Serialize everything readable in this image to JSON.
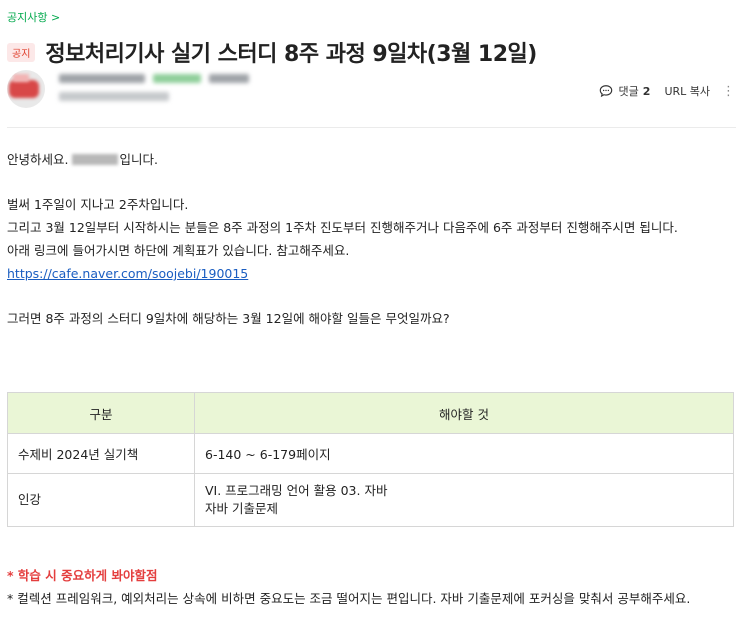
{
  "board": {
    "link_label": "공지사항 >"
  },
  "post": {
    "badge": "공지",
    "title": "정보처리기사 실기 스터디 8주 과정 9일차(3월 12일)"
  },
  "actions": {
    "comment_label": "댓글",
    "comment_count": "2",
    "url_copy": "URL 복사",
    "more": "⋮"
  },
  "body": {
    "greeting_before": "안녕하세요. ",
    "greeting_after": "입니다.",
    "line1": "벌써 1주일이 지나고 2주차입니다.",
    "line2": "그리고 3월 12일부터 시작하시는 분들은 8주 과정의 1주차 진도부터 진행해주거나 다음주에 6주 과정부터 진행해주시면 됩니다.",
    "line3": "아래 링크에 들어가시면 하단에 계획표가 있습니다. 참고해주세요.",
    "link": "https://cafe.naver.com/soojebi/190015",
    "question": "그러면 8주 과정의 스터디 9일차에 해당하는 3월 12일에 해야할 일들은 무엇일까요?"
  },
  "table": {
    "headers": [
      "구분",
      "해야할 것"
    ],
    "rows": [
      {
        "label": "수제비 2024년 실기책",
        "task_line1": "6-140 ~ 6-179페이지",
        "task_line2": ""
      },
      {
        "label": "인강",
        "task_line1": "VI. 프로그래밍 언어 활용 03. 자바",
        "task_line2": "자바 기출문제"
      }
    ]
  },
  "notes": {
    "title": "* 학습 시 중요하게 봐야할점",
    "text": "* 컬렉션 프레임워크, 예외처리는 상속에 비하면 중요도는 조금 떨어지는 편입니다. 자바 기출문제에 포커싱을 맞춰서 공부해주세요."
  },
  "colors": {
    "accent_green": "#03a94d",
    "notice_red": "#e0402e",
    "table_header_bg": "#eaf6d6",
    "link_blue": "#1a5dc1"
  }
}
